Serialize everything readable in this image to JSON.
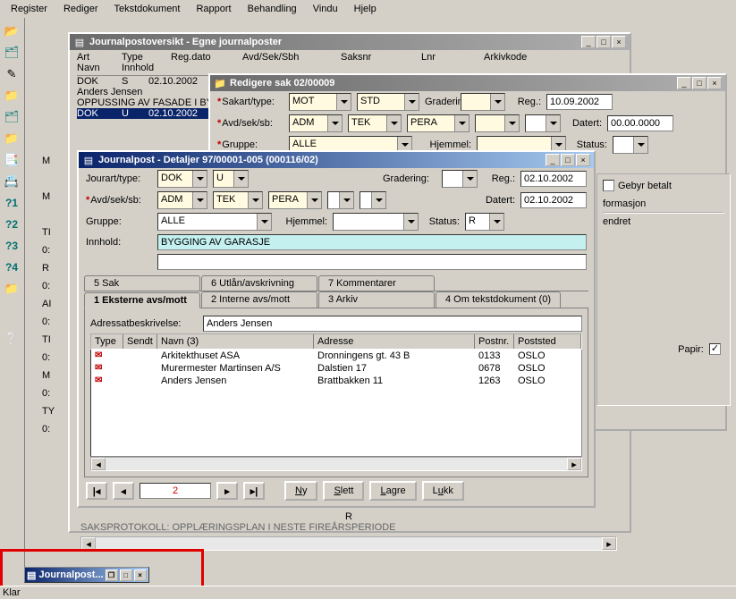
{
  "menubar": [
    "Register",
    "Rediger",
    "Tekstdokument",
    "Rapport",
    "Behandling",
    "Vindu",
    "Hjelp"
  ],
  "win1": {
    "title": "Journalpostoversikt - Egne journalposter",
    "cols": [
      "Art",
      "Type",
      "Reg.dato",
      "Avd/Sek/Sbh",
      "Saksnr",
      "Lnr",
      "Arkivkode"
    ],
    "cols2": [
      "Navn",
      "Innhold"
    ],
    "rows": [
      {
        "art": "DOK",
        "type": "S",
        "dato": "02.10.2002",
        "navn": "Anders Jensen",
        "innhold": "OPPUSSING AV FASADE I BY"
      },
      {
        "art": "DOK",
        "type": "U",
        "dato": "02.10.2002"
      }
    ]
  },
  "win2": {
    "title": "Redigere sak 02/00009",
    "labels": {
      "sakart": "Sakart/type:",
      "avd": "Avd/sek/sb:",
      "gruppe": "Gruppe:",
      "gradering": "Gradering:",
      "reg": "Reg.:",
      "datert": "Datert:",
      "status": "Status:",
      "hjemmel": "Hjemmel:"
    },
    "vals": {
      "sakart": "MOT",
      "sakart2": "STD",
      "avd": "ADM",
      "sek": "TEK",
      "sbh": "PERA",
      "gruppe": "ALLE",
      "reg": "10.09.2002",
      "datert": "00.00.0000"
    }
  },
  "win3": {
    "title": "Journalpost - Detaljer 97/00001-005 (000116/02)",
    "labels": {
      "jourart": "Jourart/type:",
      "avd": "Avd/sek/sb:",
      "gruppe": "Gruppe:",
      "gradering": "Gradering:",
      "reg": "Reg.:",
      "datert": "Datert:",
      "status": "Status:",
      "hjemmel": "Hjemmel:",
      "innhold": "Innhold:",
      "adr": "Adressatbeskrivelse:"
    },
    "vals": {
      "jourart": "DOK",
      "type": "U",
      "avd": "ADM",
      "sek": "TEK",
      "sbh": "PERA",
      "gruppe": "ALLE",
      "status": "R",
      "reg": "02.10.2002",
      "datert": "02.10.2002",
      "innhold": "BYGGING AV GARASJE",
      "adr": "Anders Jensen"
    },
    "tabs1": [
      "5 Sak",
      "6 Utlån/avskrivning",
      "7 Kommentarer"
    ],
    "tabs2": [
      "1 Eksterne avs/mott",
      "2 Interne avs/mott",
      "3 Arkiv",
      "4 Om tekstdokument (0)"
    ],
    "listcols": [
      "Type",
      "Sendt",
      "Navn (3)",
      "Adresse",
      "Postnr.",
      "Poststed"
    ],
    "listrows": [
      {
        "navn": "Arkitekthuset ASA",
        "adr": "Dronningens gt. 43 B",
        "postnr": "0133",
        "sted": "OSLO"
      },
      {
        "navn": "Murermester Martinsen A/S",
        "adr": "Dalstien 17",
        "postnr": "0678",
        "sted": "OSLO"
      },
      {
        "navn": "Anders Jensen",
        "adr": "Brattbakken 11",
        "postnr": "1263",
        "sted": "OSLO"
      }
    ],
    "nav_counter": "2",
    "btns": {
      "ny": "Ny",
      "slett": "Slett",
      "lagre": "Lagre",
      "lukk": "Lukk"
    },
    "below": "R",
    "footer": "SAKSPROTOKOLL: OPPLÆRINGSPLAN I NESTE FIREÅRSPERIODE"
  },
  "side": {
    "gebyr": "Gebyr betalt",
    "formasjon": "formasjon",
    "endret": "endret",
    "papir": "Papir:"
  },
  "taskbar": "Journalpost...",
  "status": "Klar"
}
